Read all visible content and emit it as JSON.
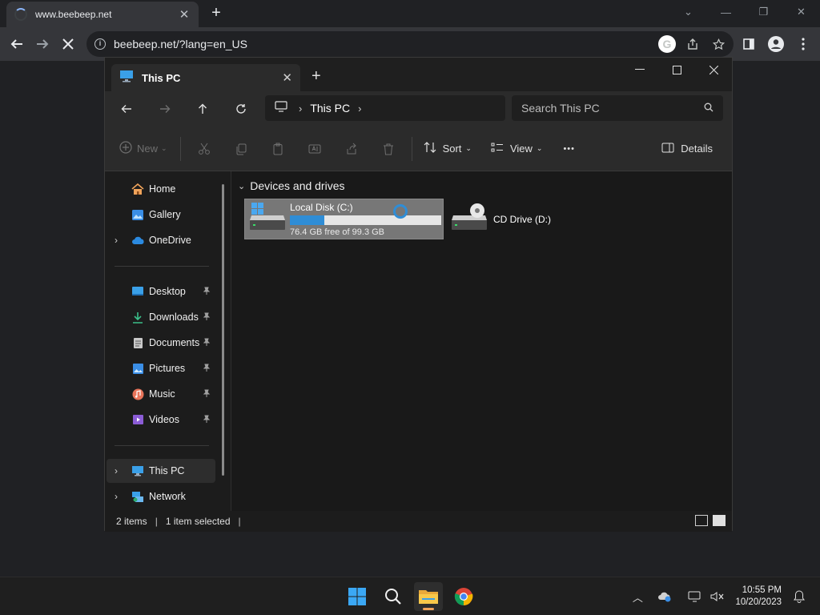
{
  "browser": {
    "tab_title": "www.beebeep.net",
    "tab_close": "✕",
    "new_tab": "+",
    "url": "beebeep.net/?lang=en_US",
    "controls": {
      "minimize": "⌄",
      "minimize2": "—",
      "restore": "❐",
      "close": "✕"
    }
  },
  "explorer": {
    "tab_title": "This PC",
    "tab_close": "✕",
    "new_tab": "+",
    "address": {
      "crumb": "This PC",
      "sep": "›"
    },
    "search_placeholder": "Search This PC",
    "commands": {
      "new_label": "New",
      "sort_label": "Sort",
      "view_label": "View",
      "more_label": "•••",
      "details_label": "Details"
    },
    "nav": {
      "home": "Home",
      "gallery": "Gallery",
      "onedrive": "OneDrive",
      "desktop": "Desktop",
      "downloads": "Downloads",
      "documents": "Documents",
      "pictures": "Pictures",
      "music": "Music",
      "videos": "Videos",
      "this_pc": "This PC",
      "network": "Network"
    },
    "content": {
      "group_header": "Devices and drives",
      "drive_c": {
        "name": "Local Disk (C:)",
        "free_text": "76.4 GB free of 99.3 GB",
        "used_fraction": 0.23
      },
      "drive_d": {
        "name": "CD Drive (D:)"
      }
    },
    "status": {
      "items": "2 items",
      "selected": "1 item selected",
      "pipe": "|"
    }
  },
  "taskbar": {
    "time": "10:55 PM",
    "date": "10/20/2023",
    "tray_chevron": "︿"
  },
  "colors": {
    "accent": "#2f8dd6",
    "chrome_bg": "#202124",
    "explorer_bg": "#1c1c1c"
  }
}
